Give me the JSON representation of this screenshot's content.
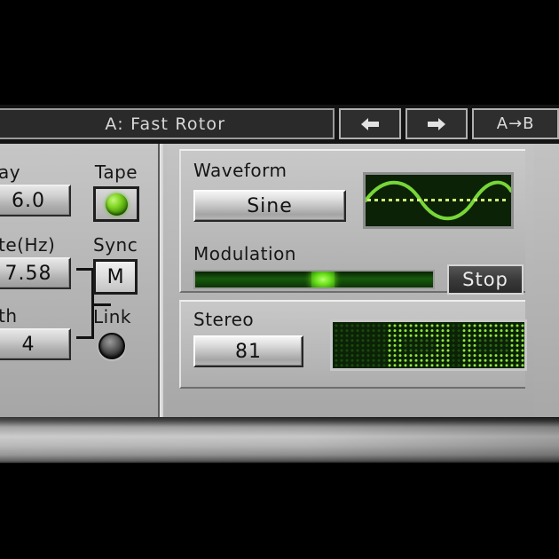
{
  "header": {
    "preset_name": "A: Fast Rotor",
    "prev_label": "←",
    "next_label": "→",
    "copy_ab_label": "A→B",
    "prev_icon": "arrow-left-icon",
    "next_icon": "arrow-right-icon"
  },
  "left_panel": {
    "delay": {
      "label": "ay",
      "value": "6.0"
    },
    "rate": {
      "label": "te(Hz)",
      "value": "7.58"
    },
    "width": {
      "label": "th",
      "value": "4"
    },
    "tape": {
      "label": "Tape",
      "state": "on"
    },
    "sync": {
      "label": "Sync",
      "value": "M"
    },
    "link": {
      "label": "Link",
      "state": "off"
    }
  },
  "waveform_group": {
    "label": "Waveform",
    "selected": "Sine",
    "modulation_label": "Modulation",
    "modulation_value": 50,
    "stop_label": "Stop"
  },
  "stereo_group": {
    "label": "Stereo",
    "value": "81"
  },
  "colors": {
    "panel": "#b8b8b8",
    "led_green": "#7ed321",
    "lcd_bg": "#0b2207",
    "lcd_trace": "#7ee03a",
    "header_bg": "#141414",
    "text": "#161616"
  }
}
